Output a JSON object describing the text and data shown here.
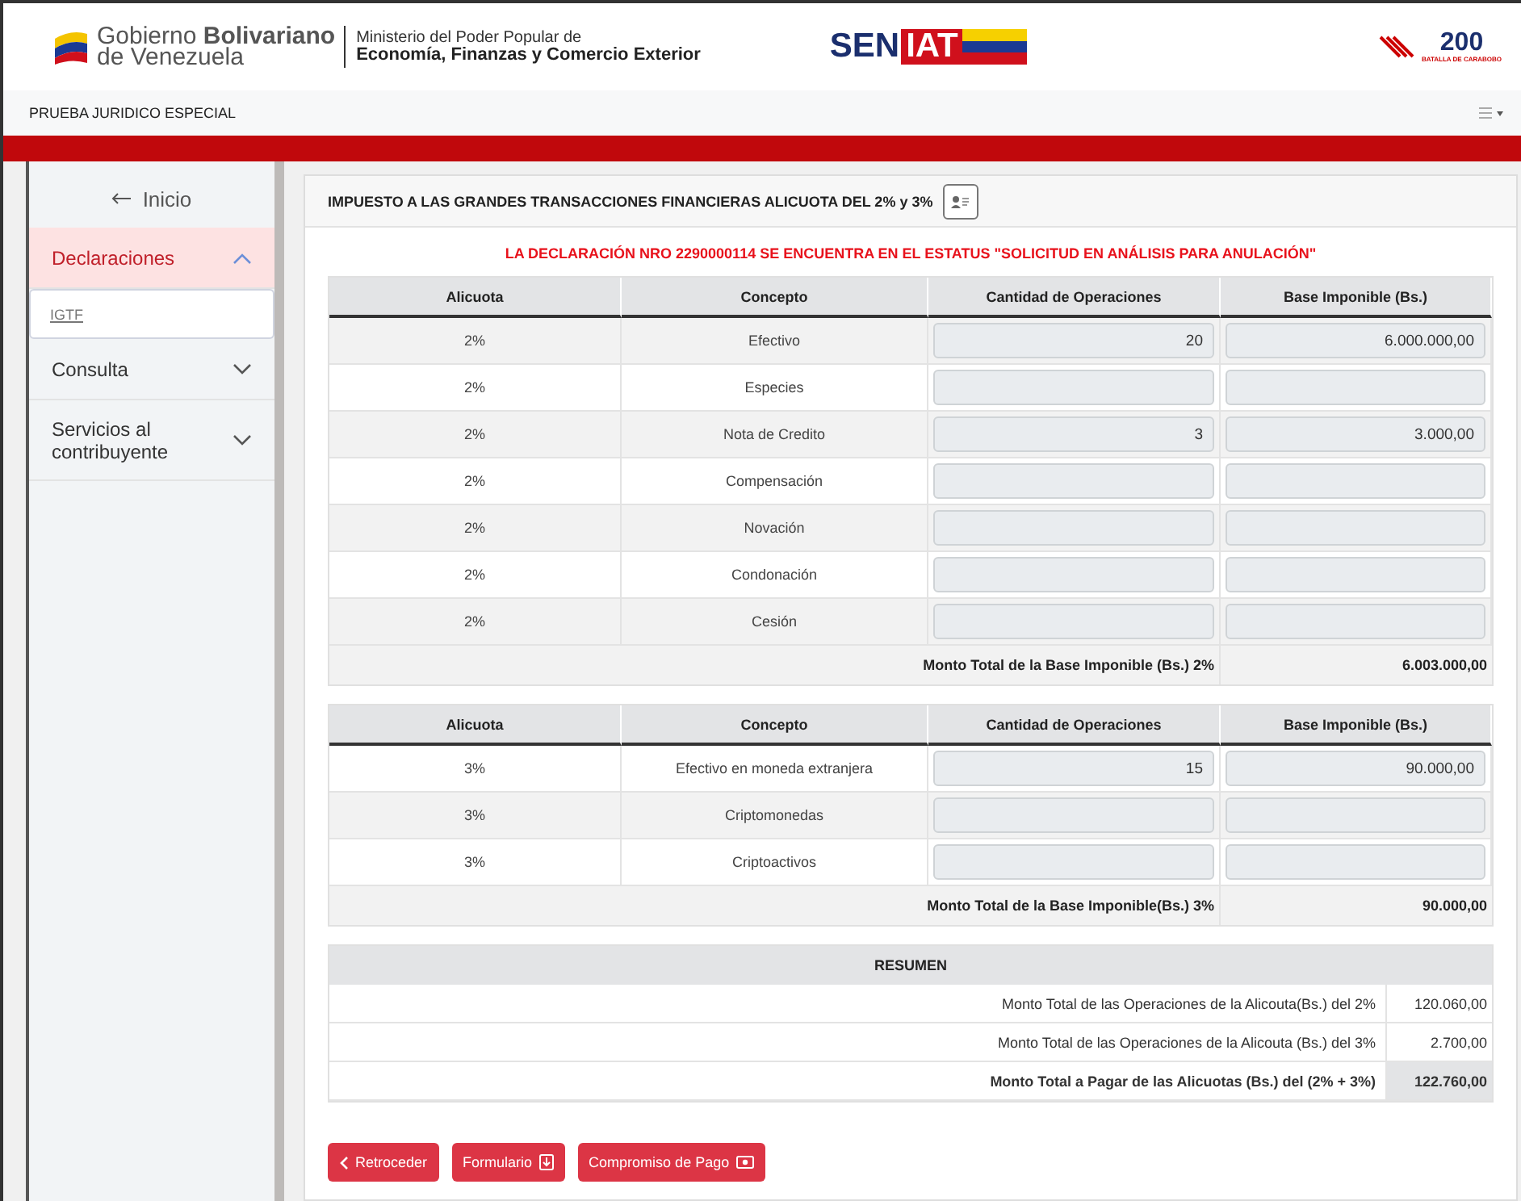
{
  "header": {
    "government": {
      "line_1": "Gobierno **Bolivariano**",
      "line_2": "de Venezuela"
    },
    "ministry": {
      "line_1": "Ministerio del Poder Popular de",
      "line_2": "Economía, Finanzas y Comercio Exterior"
    },
    "seniat_logo": {
      "part_1": "SEN",
      "part_2": "IAT"
    },
    "anniversary_logo": {
      "number": "200",
      "caption": "BATALLA DE CARABOBO"
    }
  },
  "navbar": {
    "user": "PRUEBA JURIDICO ESPECIAL"
  },
  "sidebar": {
    "back_link": "Inicio",
    "items": [
      {
        "label": "Declaraciones",
        "expanded": true,
        "selected": true,
        "children": [
          {
            "label": "IGTF"
          }
        ]
      },
      {
        "label": "Consulta",
        "expanded": false,
        "selected": false
      },
      {
        "label": "Servicios al contribuyente",
        "expanded": false,
        "selected": false
      }
    ]
  },
  "card": {
    "title": "IMPUESTO A LAS GRANDES TRANSACCIONES FINANCIERAS ALICUOTA DEL 2% y 3%",
    "status_message": "LA DECLARACIÓN NRO 2290000114 SE ENCUENTRA EN EL ESTATUS \"SOLICITUD EN ANÁLISIS PARA ANULACIÓN\"",
    "tables": [
      {
        "columns": [
          "Alicuota",
          "Concepto",
          "Cantidad de Operaciones",
          "Base Imponible (Bs.)"
        ],
        "rows": [
          {
            "alicuota": "2%",
            "concepto": "Efectivo",
            "cantidad": "20",
            "base": "6.000.000,00"
          },
          {
            "alicuota": "2%",
            "concepto": "Especies"
          },
          {
            "alicuota": "2%",
            "concepto": "Nota de Credito",
            "cantidad": "3",
            "base": "3.000,00"
          },
          {
            "alicuota": "2%",
            "concepto": "Compensación"
          },
          {
            "alicuota": "2%",
            "concepto": "Novación"
          },
          {
            "alicuota": "2%",
            "concepto": "Condonación"
          },
          {
            "alicuota": "2%",
            "concepto": "Cesión"
          }
        ],
        "total_label": "Monto Total de la Base Imponible (Bs.) 2%",
        "total_value": "6.003.000,00"
      },
      {
        "columns": [
          "Alicuota",
          "Concepto",
          "Cantidad de Operaciones",
          "Base Imponible (Bs.)"
        ],
        "rows": [
          {
            "alicuota": "3%",
            "concepto": "Efectivo en moneda extranjera",
            "cantidad": "15",
            "base": "90.000,00"
          },
          {
            "alicuota": "3%",
            "concepto": "Criptomonedas"
          },
          {
            "alicuota": "3%",
            "concepto": "Criptoactivos"
          }
        ],
        "total_label": "Monto Total de la Base Imponible(Bs.) 3%",
        "total_value": "90.000,00"
      }
    ],
    "summary": {
      "title": "RESUMEN",
      "rows": [
        {
          "label": "Monto Total de las Operaciones de la Alicouta(Bs.) del 2%",
          "value": "120.060,00",
          "kind": "line"
        },
        {
          "label": "Monto Total de las Operaciones de la Alicouta (Bs.) del 3%",
          "value": "2.700,00",
          "kind": "line"
        },
        {
          "label": "Monto Total a Pagar de las Alicuotas (Bs.) del (2% + 3%)",
          "value": "122.760,00",
          "kind": "total"
        }
      ]
    },
    "buttons": [
      {
        "label": "Retroceder",
        "kind": "back"
      },
      {
        "label": "Formulario",
        "kind": "download"
      },
      {
        "label": "Compromiso de Pago",
        "kind": "payment"
      }
    ]
  }
}
